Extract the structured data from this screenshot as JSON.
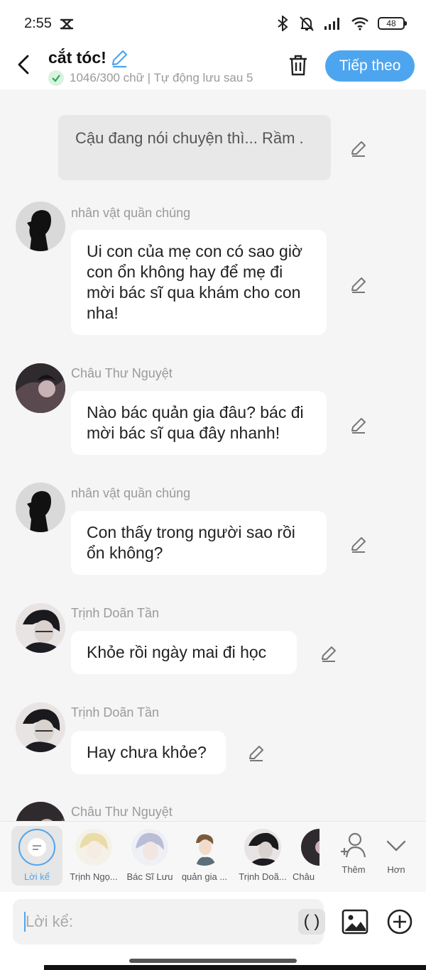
{
  "status_bar": {
    "time": "2:55",
    "battery": "48",
    "icons": [
      "bluetooth-icon",
      "mute-icon",
      "signal-icon",
      "wifi-icon",
      "battery-icon"
    ]
  },
  "header": {
    "title": "cắt tóc!",
    "sub_info": "1046/300 chữ | Tự động lưu sau 5",
    "next_label": "Tiếp theo"
  },
  "chat": {
    "narration": "Cậu đang nói chuyện thì... Rầm .",
    "messages": [
      {
        "name": "nhân vật quần chúng",
        "text": "Ui con của mẹ con có sao giờ con ổn không hay để mẹ đi mời bác sĩ qua khám cho con nha!"
      },
      {
        "name": "Châu Thư Nguyệt",
        "text": "Nào bác quản gia đâu? bác đi mời bác sĩ qua đây nhanh!"
      },
      {
        "name": "nhân vật quần chúng",
        "text": "Con thấy trong người sao rồi ổn không?"
      },
      {
        "name": "Trịnh Doãn Tần",
        "text": "Khỏe rồi ngày mai đi học"
      },
      {
        "name": "Trịnh Doãn Tần",
        "text": "Hay chưa khỏe?"
      },
      {
        "name": "Châu Thư Nguyệt",
        "text": ""
      }
    ]
  },
  "character_bar": {
    "narration_label": "Lời kể",
    "characters": [
      "Trịnh Ngọ...",
      "Bác Sĩ Lưu",
      "quản gia ...",
      "Trịnh Doã...",
      "Châu"
    ],
    "add_label": "Thêm",
    "more_label": "Hơn"
  },
  "composer": {
    "placeholder": "Lời kể:",
    "paren_label": "( )"
  },
  "colors": {
    "accent": "#4ea5ef",
    "background": "#f5f5f5",
    "bubble": "#ffffff",
    "narration_bubble": "#e8e8e8"
  }
}
